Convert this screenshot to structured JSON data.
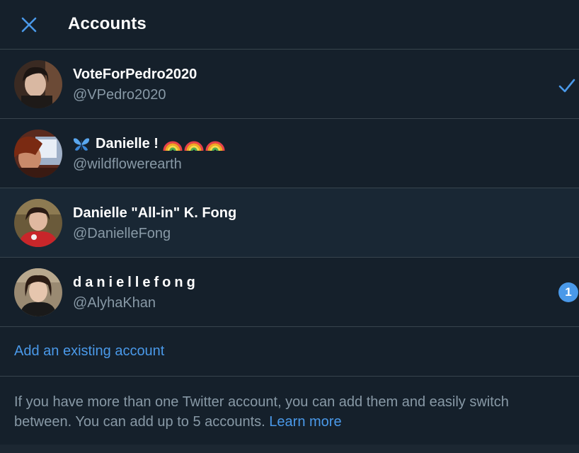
{
  "header": {
    "title": "Accounts",
    "close_icon": "close-icon"
  },
  "accounts": [
    {
      "name": "VoteForPedro2020",
      "handle": "@VPedro2020",
      "selected": true
    },
    {
      "name": "Danielle !",
      "handle": "@wildflowerearth",
      "prefix_icon": "butterfly-icon",
      "suffix_icons": [
        "rainbow-icon",
        "rainbow-icon",
        "rainbow-icon"
      ]
    },
    {
      "name": "Danielle \"All-in\" K. Fong",
      "handle": "@DanielleFong"
    },
    {
      "name": "daniellefong",
      "handle": "@AlyhaKhan",
      "notification_count": "1"
    }
  ],
  "add_account": {
    "label": "Add an existing account"
  },
  "footer": {
    "text": "If you have more than one Twitter account, you can add them and easily switch between. You can add up to 5 accounts.",
    "learn_more": "Learn more"
  },
  "colors": {
    "background": "#15202b",
    "accent": "#4a99e9",
    "muted_text": "#8899a6",
    "divider": "#38444d"
  }
}
